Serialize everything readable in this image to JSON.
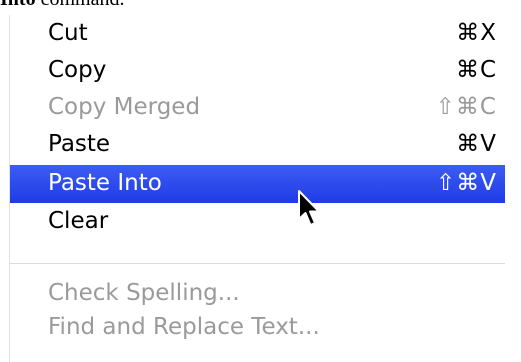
{
  "caption": {
    "bold": "Into",
    "rest": " command."
  },
  "menu": {
    "items": [
      {
        "label": "Cut",
        "shortcut": "⌘X",
        "state": "enabled"
      },
      {
        "label": "Copy",
        "shortcut": "⌘C",
        "state": "enabled"
      },
      {
        "label": "Copy Merged",
        "shortcut": "⇧⌘C",
        "state": "disabled"
      },
      {
        "label": "Paste",
        "shortcut": "⌘V",
        "state": "enabled"
      },
      {
        "label": "Paste Into",
        "shortcut": "⇧⌘V",
        "state": "selected"
      },
      {
        "label": "Clear",
        "shortcut": "",
        "state": "enabled"
      },
      {
        "label": "Check Spelling...",
        "shortcut": "",
        "state": "disabled"
      },
      {
        "label": "Find and Replace Text...",
        "shortcut": "",
        "state": "disabled"
      }
    ]
  },
  "colors": {
    "selection": "#2a47ec",
    "disabled_text": "#9a9a9a"
  },
  "icons": {
    "cursor": "arrow-pointer-icon"
  }
}
